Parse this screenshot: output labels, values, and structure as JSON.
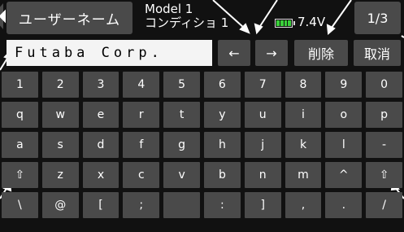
{
  "header": {
    "title": "ユーザーネーム",
    "model_name": "Model 1",
    "condition": "コンディショ 1",
    "voltage": "7.4V",
    "page": "1/3"
  },
  "input": {
    "value": "Futaba Corp."
  },
  "edit_buttons": {
    "left": "←",
    "right": "→",
    "delete": "削除",
    "cancel": "取消"
  },
  "keyboard": {
    "rows": [
      [
        "1",
        "2",
        "3",
        "4",
        "5",
        "6",
        "7",
        "8",
        "9",
        "0"
      ],
      [
        "q",
        "w",
        "e",
        "r",
        "t",
        "y",
        "u",
        "i",
        "o",
        "p"
      ],
      [
        "a",
        "s",
        "d",
        "f",
        "g",
        "h",
        "j",
        "k",
        "l",
        "-"
      ],
      [
        "⇧",
        "z",
        "x",
        "c",
        "v",
        "b",
        "n",
        "m",
        "^",
        "⇧"
      ],
      [
        "\\",
        "@",
        "[",
        ";",
        " ",
        ":",
        "]",
        ",",
        ".",
        "/"
      ]
    ]
  },
  "colors": {
    "background": "#111111",
    "key": "#4a4a4a",
    "input_bg": "#f4f4f4",
    "battery": "#3ad13a"
  }
}
